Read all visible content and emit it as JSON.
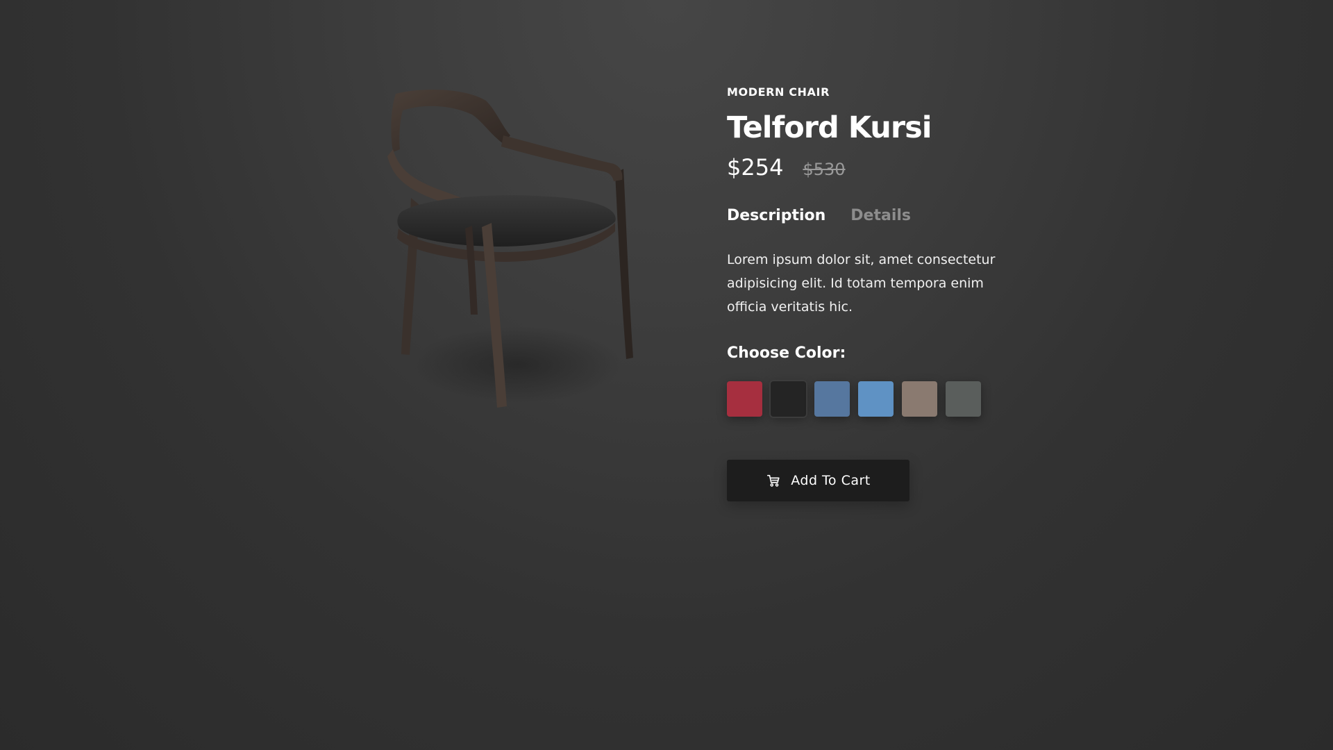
{
  "product": {
    "category": "MODERN CHAIR",
    "name": "Telford Kursi",
    "price": "$254",
    "old_price": "$530",
    "image_icon": "chair-product-image"
  },
  "tabs": [
    {
      "label": "Description",
      "active": true
    },
    {
      "label": "Details",
      "active": false
    }
  ],
  "description": "Lorem ipsum dolor sit, amet consectetur adipisicing elit. Id totam tempora enim officia veritatis hic.",
  "colors": {
    "label": "Choose Color:",
    "swatches": [
      {
        "name": "red",
        "color": "#a62f3f"
      },
      {
        "name": "black",
        "color": "#242424"
      },
      {
        "name": "denim-blue",
        "color": "#56779f"
      },
      {
        "name": "light-blue",
        "color": "#5f92c4"
      },
      {
        "name": "beige",
        "color": "#8a7a70"
      },
      {
        "name": "gray",
        "color": "#5a5e5c"
      }
    ]
  },
  "cart": {
    "label": "Add To Cart",
    "icon": "cart-icon"
  },
  "theme": {
    "background": "#3a3a3a",
    "button_bg": "#1d1d1d",
    "muted_text": "#8d8d8d"
  }
}
